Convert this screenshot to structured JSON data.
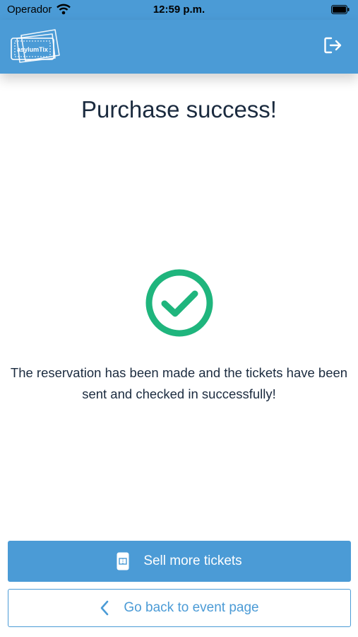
{
  "status_bar": {
    "carrier": "Operador",
    "time": "12:59 p.m."
  },
  "header": {
    "logo_text": "asylumTix",
    "logout_icon": "logout-icon"
  },
  "main": {
    "title": "Purchase success!",
    "icon": "check-circle-icon",
    "message": "The reservation has been made and the tickets have been sent and checked in successfully!"
  },
  "actions": {
    "sell_more_label": "Sell more tickets",
    "sell_more_icon": "ticket-icon",
    "back_label": "Go back to event page",
    "back_icon": "chevron-left-icon"
  },
  "colors": {
    "primary": "#4b9bd6",
    "success": "#1fb57d",
    "text": "#1b2b3f"
  }
}
